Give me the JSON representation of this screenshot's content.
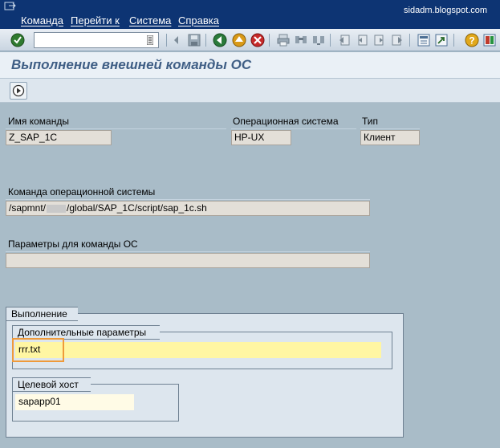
{
  "menu": {
    "items": [
      "Команда",
      "Перейти к",
      "Система",
      "Справка"
    ],
    "watermark": "sidadm.blogspot.com"
  },
  "toolbar": {
    "command_value": "",
    "icons": [
      "enter-icon",
      "save-icon",
      "back-icon",
      "exit-icon",
      "cancel-icon",
      "print-icon",
      "find-icon",
      "find-next-icon",
      "first-page-icon",
      "prev-page-icon",
      "next-page-icon",
      "last-page-icon",
      "new-session-icon",
      "shortcut-icon",
      "help-icon",
      "layout-icon"
    ]
  },
  "title": "Выполнение внешней команды ОС",
  "form": {
    "command_name_label": "Имя команды",
    "command_name_value": "Z_SAP_1C",
    "os_label": "Операционная система",
    "os_value": "HP-UX",
    "type_label": "Тип",
    "type_value": "Клиент",
    "os_command_label": "Команда операционной системы",
    "os_command_prefix": "/sapmnt/",
    "os_command_suffix": "/global/SAP_1C/script/sap_1c.sh",
    "params_label": "Параметры для команды ОС",
    "params_value": ""
  },
  "execution": {
    "group_title": "Выполнение",
    "extra_params_title": "Дополнительные параметры",
    "extra_params_value": "rrr.txt",
    "target_host_title": "Целевой хост",
    "target_host_value": "sapapp01"
  },
  "colors": {
    "menubar": "#0d3473",
    "background": "#a9bcc8",
    "highlight": "#ef9a3a",
    "input_yellow": "#fff6a3"
  }
}
